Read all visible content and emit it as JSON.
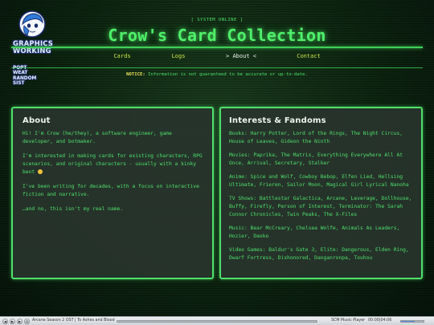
{
  "header": {
    "system_status": "[ SYSTEM ONLINE ]",
    "title": "Crow's Card Collection",
    "notice_label": "NOTICE:",
    "notice_text": "Information is not guaranteed to be accurate or up-to-date."
  },
  "logo": {
    "title_line1": "GRAPHICS",
    "title_line2": "WORKING",
    "subtitle_lines": [
      "POPT",
      "WEAT",
      "RANDOM",
      "SIST"
    ]
  },
  "nav": {
    "items": [
      "Cards",
      "Logs",
      "> About <",
      "Contact"
    ],
    "active_index": 2
  },
  "about": {
    "heading": "About",
    "paragraphs": [
      "Hi! I'm Crow (he/they), a software engineer, game developer, and botmaker.",
      "I'm interested in making cards for existing characters, RPG scenarios, and original characters - usually with a kinky bent",
      "I've been writing for decades, with a focus on interactive fiction and narrative.",
      "…and no, this isn't my real name."
    ]
  },
  "interests": {
    "heading": "Interests & Fandoms",
    "items": [
      "Books: Harry Potter, Lord of the Rings, The Night Circus, House of Leaves, Gideon the Ninth",
      "Movies: Paprika, The Matrix, Everything Everywhere All At Once, Arrival, Secretary, Stalker",
      "Anime: Spice and Wolf, Cowboy Bebop, Elfen Lied, Hellsing Ultimate, Frieren, Sailor Moon, Magical Girl Lyrical Nanoha",
      "TV Shows: Battlestar Galactica, Arcane, Leverage, Dollhouse, Buffy, Firefly, Person of Interest, Terminator: The Sarah Connor Chronicles, Twin Peaks, The X-Files",
      "Music: Bear McCreary, Chelsea Wolfe, Animals As Leaders, Hozier, Daoko",
      "Video Games: Baldur's Gate 3, Elite: Dangerous, Elden Ring, Dwarf Fortress, Dishonored, Danganronpa, Touhou"
    ]
  },
  "player": {
    "track": "Arcane Season 2 OST | To Ashes and Blood",
    "name": "SCM Music Player",
    "time": "00:00|04:06",
    "progress": 0.0,
    "volume": 0.6
  },
  "colors": {
    "accent_green": "#4fe06a",
    "nav_yellow": "#cde64a",
    "notice_yellow": "#e8e05a",
    "panel_bg": "#28342c"
  }
}
